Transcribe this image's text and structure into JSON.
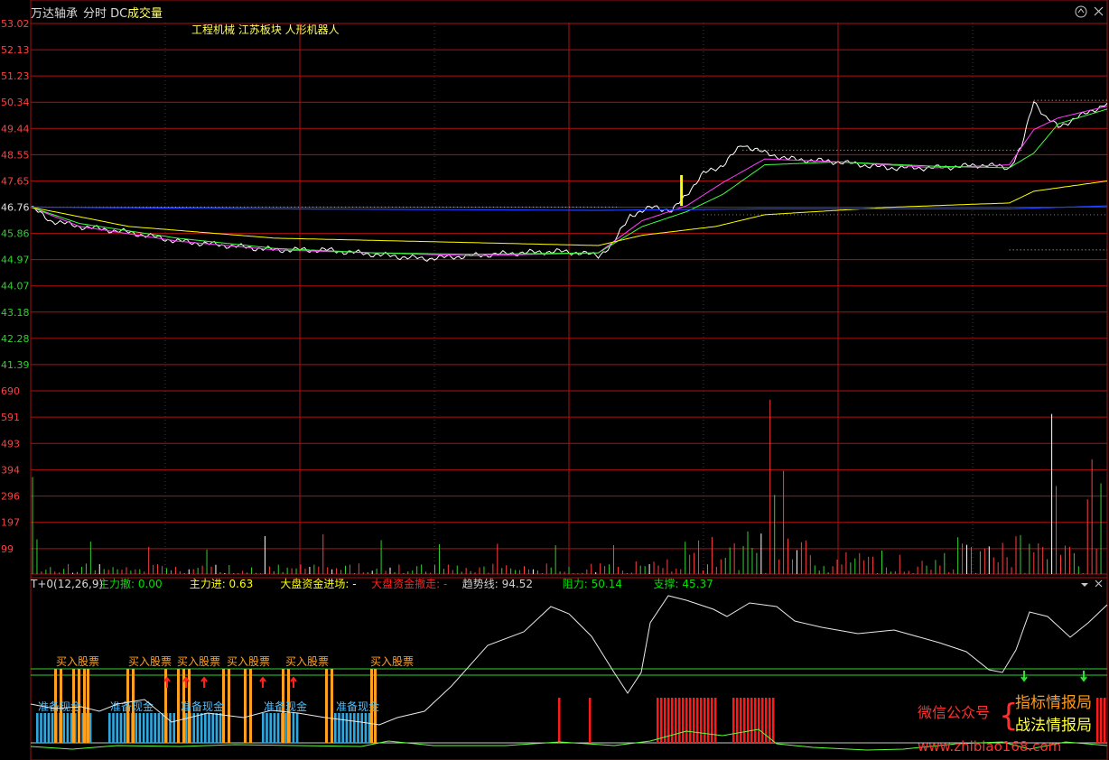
{
  "header": {
    "stock_name": "万达轴承",
    "mode": "分时 DC",
    "indicator": "成交量",
    "sectors": "工程机械 江苏板块 人形机器人",
    "toolbar_icon": "up-arrow-circle-icon",
    "close_icon": "close-icon"
  },
  "indicator_header": {
    "name": "T+0(12,26,9)",
    "items": [
      {
        "label": "主力撤: 0.00",
        "color": "#00e000"
      },
      {
        "label": "主力进: 0.63",
        "color": "#ffff00"
      },
      {
        "label": "大盘资金进场: -",
        "color": "#ffff00"
      },
      {
        "label": "大盘资金撤走: -",
        "color": "#ff2020"
      },
      {
        "label": "趋势线: 94.52",
        "color": "#d0d0d0"
      },
      {
        "label": "阻力: 50.14",
        "color": "#00e000"
      },
      {
        "label": "支撑: 45.37",
        "color": "#00e000"
      }
    ]
  },
  "watermark": {
    "wechat": "微信公众号",
    "line1": "指标情报局",
    "line2": "战法情报局",
    "url": "www.zhibiao168.com"
  },
  "chart_data": [
    {
      "type": "line",
      "panel": "price",
      "y_ticks": [
        "53.02",
        "52.13",
        "51.23",
        "50.34",
        "49.44",
        "48.55",
        "47.65",
        "46.76",
        "45.86",
        "44.97",
        "44.07",
        "43.18",
        "42.28",
        "41.39"
      ],
      "ylim": [
        41.39,
        53.02
      ],
      "prev_close": 46.76,
      "n_points": 240,
      "series": [
        {
          "key": "price",
          "color": "#ffffff",
          "points": [
            [
              0,
              46.76
            ],
            [
              8,
              46.3
            ],
            [
              20,
              46.1
            ],
            [
              40,
              45.9
            ],
            [
              60,
              45.6
            ],
            [
              80,
              45.45
            ],
            [
              100,
              45.3
            ],
            [
              120,
              45.3
            ],
            [
              140,
              45.15
            ],
            [
              160,
              45.0
            ],
            [
              180,
              45.1
            ],
            [
              200,
              45.2
            ],
            [
              215,
              45.25
            ],
            [
              225,
              45.2
            ],
            [
              232,
              45.1
            ],
            [
              238,
              45.5
            ],
            [
              245,
              46.5
            ],
            [
              250,
              46.6
            ],
            [
              255,
              46.8
            ],
            [
              262,
              46.6
            ],
            [
              268,
              47.2
            ],
            [
              275,
              47.9
            ],
            [
              283,
              48.2
            ],
            [
              291,
              48.9
            ],
            [
              300,
              48.6
            ],
            [
              310,
              48.4
            ],
            [
              330,
              48.3
            ],
            [
              350,
              48.1
            ],
            [
              370,
              48.1
            ],
            [
              390,
              48.2
            ],
            [
              400,
              48.1
            ],
            [
              405,
              48.8
            ],
            [
              410,
              50.4
            ],
            [
              415,
              49.8
            ],
            [
              420,
              49.5
            ],
            [
              430,
              49.9
            ],
            [
              440,
              50.3
            ]
          ]
        },
        {
          "key": "ma_fast",
          "color": "#ff40ff",
          "points": [
            [
              0,
              46.76
            ],
            [
              20,
              46.1
            ],
            [
              60,
              45.6
            ],
            [
              100,
              45.3
            ],
            [
              140,
              45.2
            ],
            [
              180,
              45.1
            ],
            [
              232,
              45.2
            ],
            [
              250,
              46.3
            ],
            [
              268,
              46.8
            ],
            [
              283,
              47.6
            ],
            [
              300,
              48.4
            ],
            [
              330,
              48.3
            ],
            [
              370,
              48.1
            ],
            [
              400,
              48.2
            ],
            [
              410,
              49.4
            ],
            [
              420,
              49.8
            ],
            [
              440,
              50.2
            ]
          ]
        },
        {
          "key": "ma_slow",
          "color": "#40ff40",
          "points": [
            [
              0,
              46.76
            ],
            [
              20,
              46.2
            ],
            [
              60,
              45.7
            ],
            [
              100,
              45.35
            ],
            [
              140,
              45.2
            ],
            [
              180,
              45.15
            ],
            [
              232,
              45.2
            ],
            [
              250,
              46.1
            ],
            [
              268,
              46.6
            ],
            [
              283,
              47.2
            ],
            [
              300,
              48.2
            ],
            [
              330,
              48.3
            ],
            [
              370,
              48.15
            ],
            [
              400,
              48.1
            ],
            [
              410,
              48.6
            ],
            [
              420,
              49.6
            ],
            [
              440,
              50.1
            ]
          ]
        },
        {
          "key": "avg",
          "color": "#ffff00",
          "points": [
            [
              0,
              46.76
            ],
            [
              40,
              46.1
            ],
            [
              100,
              45.7
            ],
            [
              180,
              45.55
            ],
            [
              232,
              45.45
            ],
            [
              250,
              45.8
            ],
            [
              280,
              46.1
            ],
            [
              300,
              46.5
            ],
            [
              350,
              46.75
            ],
            [
              400,
              46.9
            ],
            [
              410,
              47.3
            ],
            [
              440,
              47.65
            ]
          ]
        },
        {
          "key": "baseline",
          "color": "#2040ff",
          "points": [
            [
              0,
              46.76
            ],
            [
              100,
              46.7
            ],
            [
              232,
              46.65
            ],
            [
              300,
              46.7
            ],
            [
              400,
              46.7
            ],
            [
              440,
              46.8
            ]
          ]
        }
      ],
      "dotted_levels": [
        {
          "value": 46.76,
          "from": 0,
          "to": 240,
          "color": "#a0a0ff"
        },
        {
          "value": 48.7,
          "from": 291,
          "to": 405,
          "color": "#c8c8c8"
        },
        {
          "value": 50.4,
          "from": 410,
          "to": 440,
          "color": "#c8c8c8"
        },
        {
          "value": 45.3,
          "from": 400,
          "to": 440,
          "color": "#c8c8c8"
        },
        {
          "value": 46.5,
          "from": 275,
          "to": 440,
          "color": "#ff4040"
        }
      ],
      "marker": {
        "x": 266,
        "from": 46.8,
        "to": 47.85,
        "color": "#ffff00"
      }
    },
    {
      "type": "bar",
      "panel": "volume",
      "y_ticks": [
        "690",
        "591",
        "493",
        "394",
        "296",
        "197",
        "99"
      ],
      "ylim": [
        0,
        690
      ]
    },
    {
      "type": "line",
      "panel": "indicator",
      "signals_buy_label": "买入股票",
      "signals_cash_label": "准备现金"
    }
  ]
}
